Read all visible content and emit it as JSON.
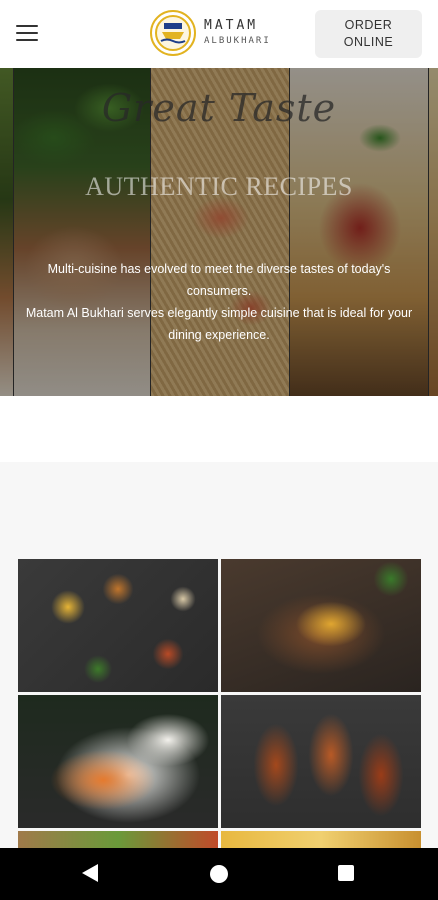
{
  "header": {
    "menu_icon": "hamburger-menu-icon",
    "logo": {
      "line1": "MATAM",
      "line2": "ALBUKHARI",
      "badge_colors": {
        "ring": "#e2b320",
        "ship": "#1f3f8a"
      }
    },
    "order_button": {
      "line1": "ORDER",
      "line2": "ONLINE"
    }
  },
  "hero": {
    "script_title": "Great Taste",
    "title": "AUTHENTIC RECIPES",
    "description_line1": "Multi-cuisine has evolved to meet the diverse tastes of today's consumers.",
    "description_line2": "Matam Al Bukhari serves elegantly simple cuisine that is ideal for your dining experience."
  },
  "gallery": {
    "tiles": [
      "spices-food-image",
      "dal-curry-image",
      "butter-chicken-rice-image",
      "chicken-wings-image",
      "food-image",
      "food-image"
    ]
  },
  "navbar": {
    "back_icon": "back-triangle-icon",
    "home_icon": "home-circle-icon",
    "recent_icon": "recent-apps-square-icon"
  },
  "colors": {
    "accent": "#e2b320",
    "button_bg": "#efefef",
    "nav_bg": "#000000"
  }
}
